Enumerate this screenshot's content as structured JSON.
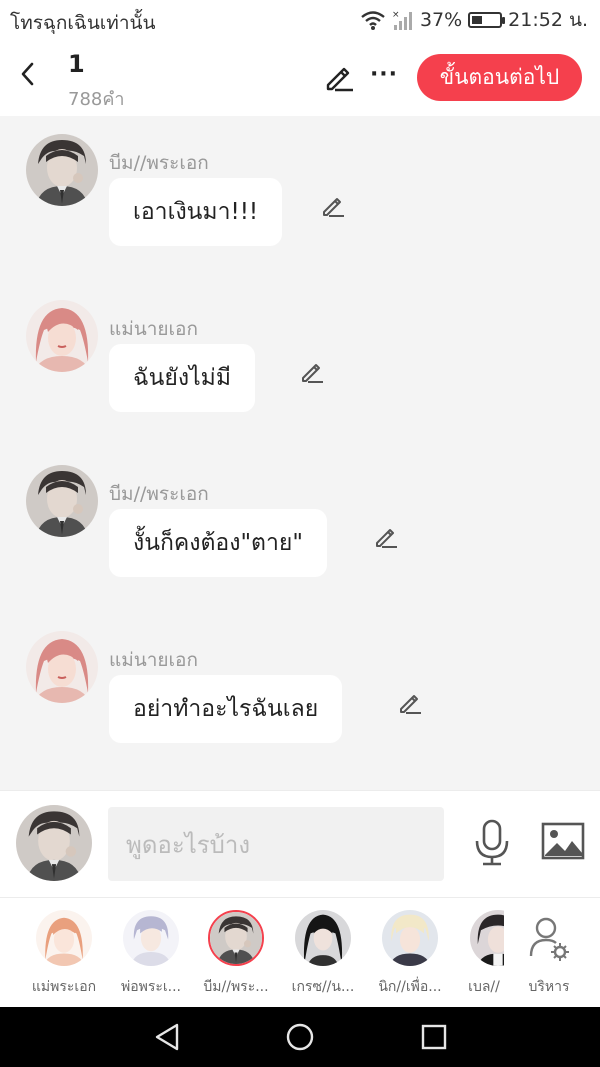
{
  "status_bar": {
    "carrier": "โทรฉุกเฉินเท่านั้น",
    "battery_percent": "37%",
    "battery_level": 0.37,
    "time": "21:52 น.",
    "icons": [
      "wifi-icon",
      "signal-icon",
      "battery-icon"
    ]
  },
  "header": {
    "title": "1",
    "word_count": "788คำ",
    "next_button": "ขั้นตอนต่อไป",
    "more_label": "···",
    "icons": [
      "back-arrow-icon",
      "edit-icon",
      "more-icon"
    ]
  },
  "messages": [
    {
      "sender": "บีม//พระเอก",
      "text": "เอาเงินมา!!!",
      "avatar": "male-lead-avatar"
    },
    {
      "sender": "แม่นายเอก",
      "text": "ฉันยังไม่มี",
      "avatar": "female-mother-avatar"
    },
    {
      "sender": "บีม//พระเอก",
      "text": "งั้นก็คงต้อง\"ตาย\"",
      "avatar": "male-lead-avatar"
    },
    {
      "sender": "แม่นายเอก",
      "text": "อย่าทำอะไรฉันเลย",
      "avatar": "female-mother-avatar"
    }
  ],
  "input": {
    "placeholder": "พูดอะไรบ้าง",
    "icons": [
      "microphone-icon",
      "image-icon"
    ]
  },
  "characters": [
    {
      "label": "แม่พระเอก",
      "selected": false
    },
    {
      "label": "พ่อพระเ...",
      "selected": false
    },
    {
      "label": "บีม//พระ...",
      "selected": true
    },
    {
      "label": "เกรซ//น...",
      "selected": false
    },
    {
      "label": "นิก//เพื่อ...",
      "selected": false
    },
    {
      "label": "เบล//",
      "selected": false
    }
  ],
  "manage_label": "บริหาร",
  "colors": {
    "accent": "#f5404d",
    "chat_background": "#f4f4f4",
    "bubble": "#ffffff"
  },
  "nav_icons": [
    "back-triangle-icon",
    "home-circle-icon",
    "recents-square-icon"
  ]
}
